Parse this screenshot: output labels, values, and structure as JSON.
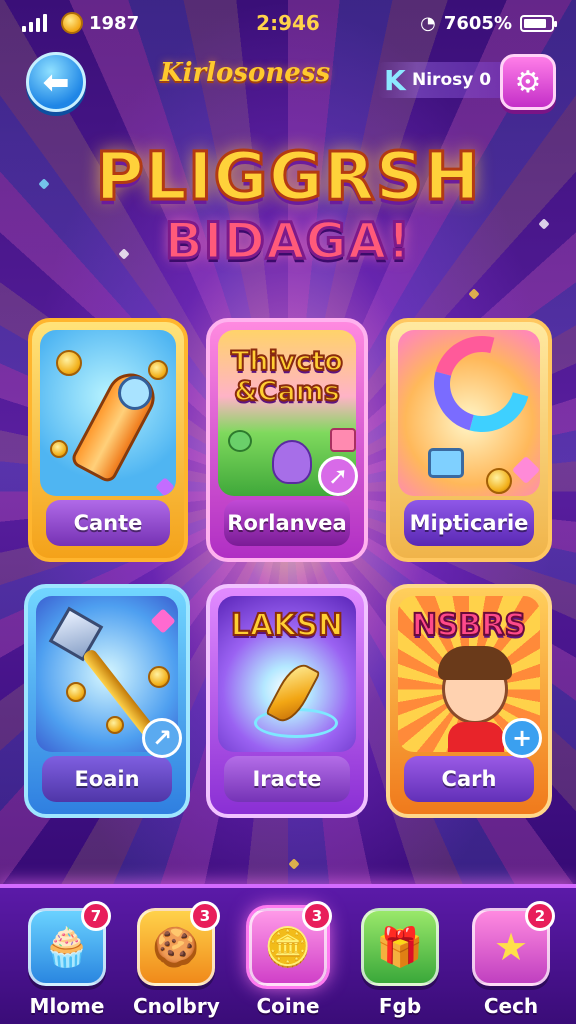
{
  "status_bar": {
    "coins": "1987",
    "time": "2:946",
    "network": "7605%"
  },
  "header": {
    "title": "Kirlosoness",
    "subtitle": "Nirosy 0"
  },
  "logo": {
    "line1": "PLIGGRSH",
    "line2": "BIDAGA!"
  },
  "cards": [
    {
      "label": "Cante"
    },
    {
      "title_line1": "Thivcto",
      "title_line2": "&Cams",
      "label": "Rorlanvea"
    },
    {
      "label": "Mipticarie"
    },
    {
      "label": "Eoain"
    },
    {
      "title": "LAKSN",
      "label": "Iracte"
    },
    {
      "title": "NSBRS",
      "label": "Carh"
    }
  ],
  "bottom_nav": [
    {
      "label": "Mlome",
      "badge": "7"
    },
    {
      "label": "Cnolbry",
      "badge": "3"
    },
    {
      "label": "Coine",
      "badge": "3"
    },
    {
      "label": "Fgb",
      "badge": ""
    },
    {
      "label": "Cech",
      "badge": "2"
    }
  ],
  "colors": {
    "accent_gold": "#ffd23a",
    "accent_pink": "#ff7af0",
    "badge_red": "#e81e5a",
    "background_purple": "#3a0f78"
  },
  "icons": {
    "back": "back-arrow-icon",
    "settings": "gear-icon",
    "nav": [
      "cupcake-icon",
      "cookie-icon",
      "coin-stack-icon",
      "gift-box-icon",
      "star-icon"
    ]
  }
}
